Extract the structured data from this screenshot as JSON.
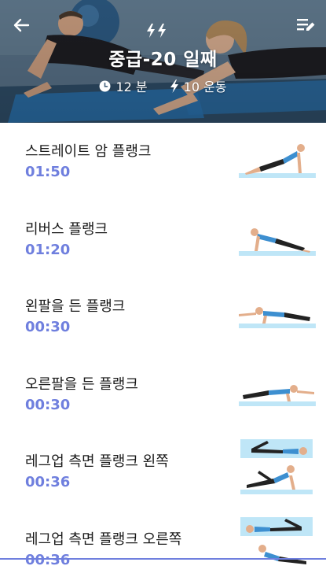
{
  "header": {
    "title": "중급-20 일째",
    "duration": "12 분",
    "exercise_count": "10 운동",
    "back_icon": "arrow-left-icon",
    "menu_icon": "edit-list-icon",
    "level_icon": "double-bolt-icon"
  },
  "exercises": [
    {
      "name": "스트레이트 암 플랭크",
      "time": "01:50",
      "illustration": "straight-arm-plank"
    },
    {
      "name": "리버스 플랭크",
      "time": "01:20",
      "illustration": "reverse-plank"
    },
    {
      "name": "왼팔을 든 플랭크",
      "time": "00:30",
      "illustration": "plank-left-arm-raised"
    },
    {
      "name": "오른팔을 든 플랭크",
      "time": "00:30",
      "illustration": "plank-right-arm-raised"
    },
    {
      "name": "레그업 측면 플랭크 왼쪽",
      "time": "00:36",
      "illustration": "side-plank-leg-up-left"
    },
    {
      "name": "레그업 측면 플랭크 오른쪽",
      "time": "00:36",
      "illustration": "side-plank-leg-up-right"
    }
  ],
  "colors": {
    "accent": "#6f7fde",
    "header_overlay": "#3f5e7c",
    "mat": "#bfe6f7",
    "shirt": "#3d8fd0"
  }
}
